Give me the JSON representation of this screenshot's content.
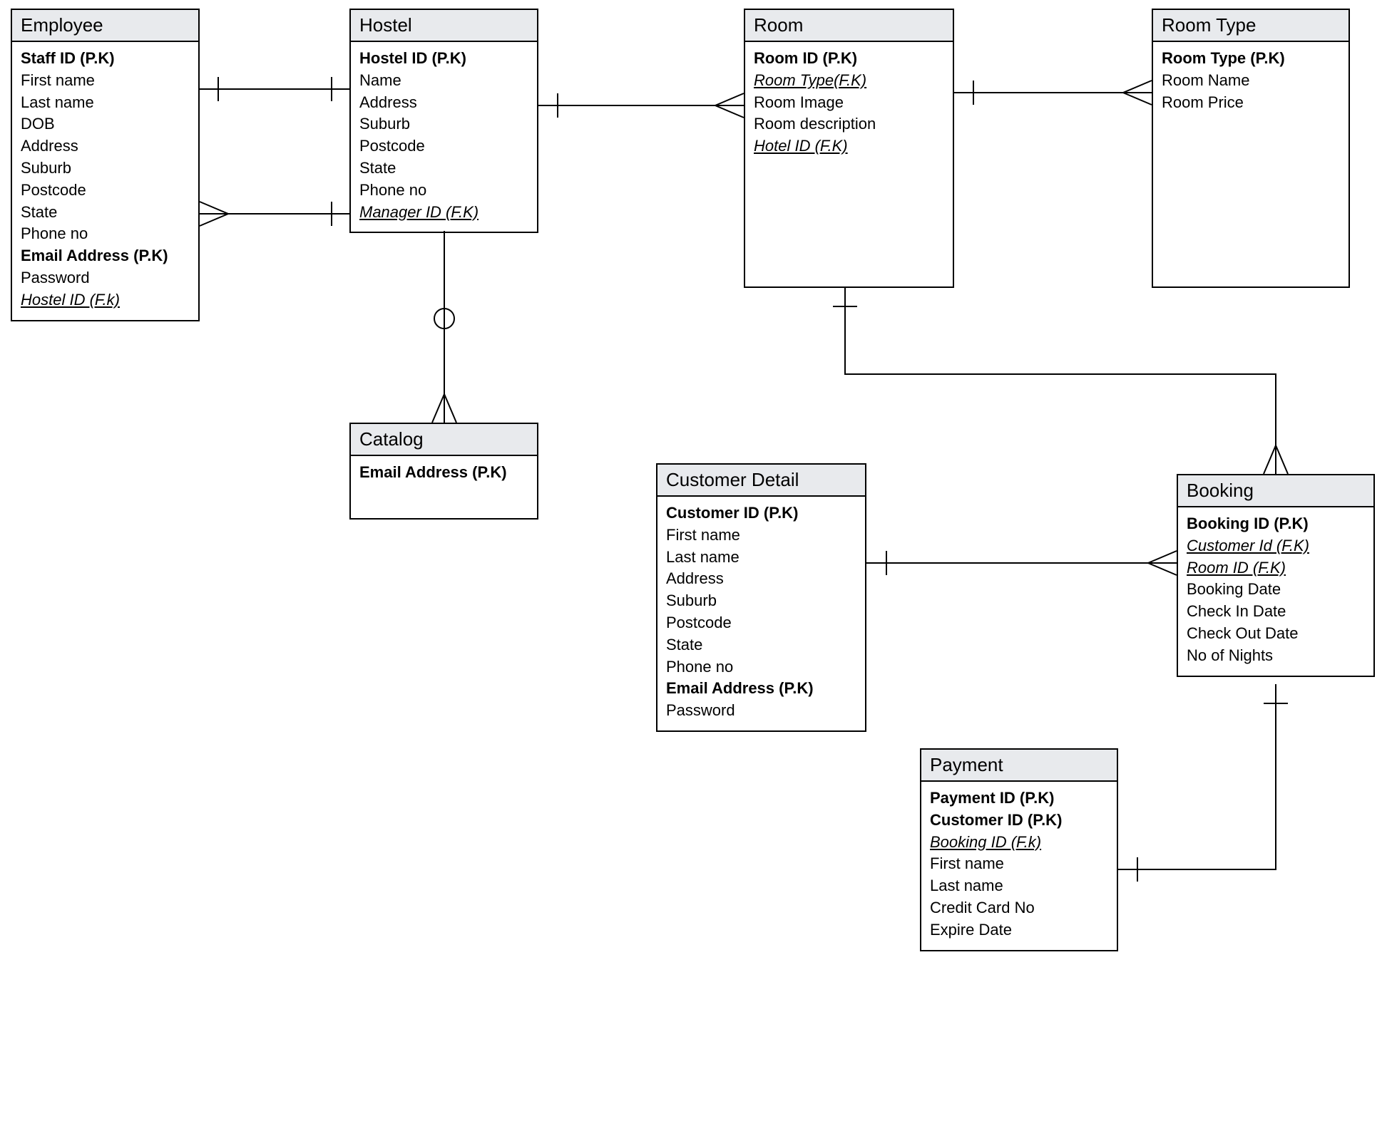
{
  "entities": {
    "employee": {
      "title": "Employee",
      "attrs": [
        {
          "text": "Staff ID (P.K)",
          "pk": true
        },
        {
          "text": "First name"
        },
        {
          "text": "Last name"
        },
        {
          "text": "DOB"
        },
        {
          "text": "Address"
        },
        {
          "text": "Suburb"
        },
        {
          "text": "Postcode"
        },
        {
          "text": "State"
        },
        {
          "text": "Phone no"
        },
        {
          "text": "Email Address (P.K)",
          "pk": true
        },
        {
          "text": "Password"
        },
        {
          "text": "Hostel ID (F.k)",
          "fk": true
        }
      ]
    },
    "hostel": {
      "title": "Hostel",
      "attrs": [
        {
          "text": "Hostel ID (P.K)",
          "pk": true
        },
        {
          "text": "Name"
        },
        {
          "text": "Address"
        },
        {
          "text": "Suburb"
        },
        {
          "text": "Postcode"
        },
        {
          "text": "State"
        },
        {
          "text": "Phone no"
        },
        {
          "text": "Manager ID (F.K)",
          "fk": true
        }
      ]
    },
    "room": {
      "title": "Room",
      "attrs": [
        {
          "text": "Room ID (P.K)",
          "pk": true
        },
        {
          "text": "Room Type(F.K)",
          "fk": true
        },
        {
          "text": "Room Image"
        },
        {
          "text": "Room description"
        },
        {
          "text": "Hotel  ID (F.K)",
          "fk": true
        }
      ]
    },
    "roomtype": {
      "title": "Room Type",
      "attrs": [
        {
          "text": "Room Type (P.K)",
          "pk": true
        },
        {
          "text": "Room Name"
        },
        {
          "text": "Room Price"
        }
      ]
    },
    "catalog": {
      "title": "Catalog",
      "attrs": [
        {
          "text": "Email Address (P.K)",
          "pk": true
        }
      ]
    },
    "customer": {
      "title": "Customer Detail",
      "attrs": [
        {
          "text": "Customer ID (P.K)",
          "pk": true
        },
        {
          "text": "First name"
        },
        {
          "text": "Last name"
        },
        {
          "text": "Address"
        },
        {
          "text": "Suburb"
        },
        {
          "text": "Postcode"
        },
        {
          "text": "State"
        },
        {
          "text": "Phone no"
        },
        {
          "text": "Email Address (P.K)",
          "pk": true
        },
        {
          "text": "Password"
        }
      ]
    },
    "booking": {
      "title": "Booking",
      "attrs": [
        {
          "text": "Booking ID (P.K)",
          "pk": true
        },
        {
          "text": "Customer Id (F.K)",
          "fk": true
        },
        {
          "text": "Room ID (F.K)",
          "fk": true
        },
        {
          "text": "Booking Date"
        },
        {
          "text": "Check In Date"
        },
        {
          "text": "Check Out Date"
        },
        {
          "text": "No of Nights"
        }
      ]
    },
    "payment": {
      "title": "Payment",
      "attrs": [
        {
          "text": "Payment ID (P.K)",
          "pk": true
        },
        {
          "text": "Customer ID (P.K)",
          "pk": true
        },
        {
          "text": "Booking ID (F.k)",
          "fk": true
        },
        {
          "text": "First name"
        },
        {
          "text": "Last name"
        },
        {
          "text": "Credit Card No"
        },
        {
          "text": "Expire Date"
        }
      ]
    }
  }
}
